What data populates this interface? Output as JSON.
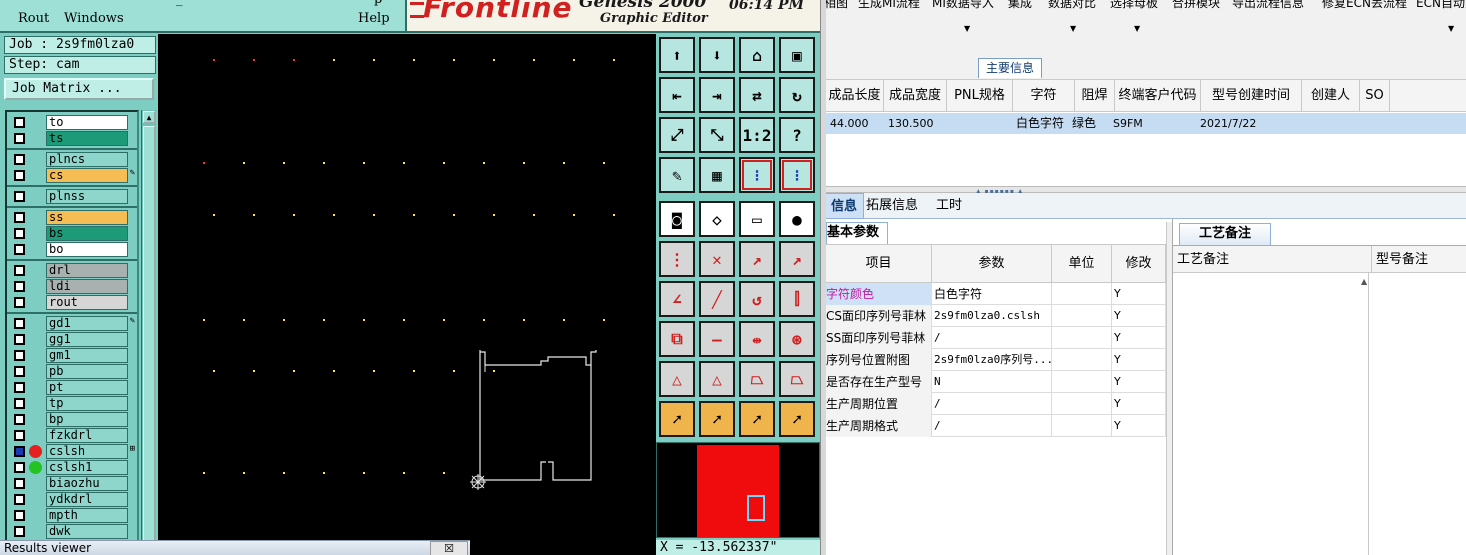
{
  "genesis": {
    "menu_top_fragments": [
      "–",
      "–",
      "–",
      "_",
      "–",
      "–",
      "p"
    ],
    "menu": [
      "Rout",
      "Windows",
      "Help"
    ],
    "brand": "Frontline",
    "product": "Genesis 2000",
    "subtitle": "Graphic Editor",
    "clock": "06:14 PM",
    "job_label": "Job : 2s9fm0lza0",
    "step_label": "Step: cam",
    "job_matrix_button": "Job Matrix ...",
    "layers": [
      {
        "name": "to",
        "color": "#ffffff",
        "flag": ""
      },
      {
        "name": "ts",
        "color": "#1d9a78",
        "flag": ""
      },
      {
        "name": "plncs",
        "color": "#8ed6cb",
        "flag": ""
      },
      {
        "name": "cs",
        "color": "#f6bd55",
        "flag": "✎"
      },
      {
        "name": "plnss",
        "color": "#8ed6cb",
        "flag": ""
      },
      {
        "name": "ss",
        "color": "#f6bd55",
        "flag": ""
      },
      {
        "name": "bs",
        "color": "#1d9a78",
        "flag": ""
      },
      {
        "name": "bo",
        "color": "#ffffff",
        "flag": ""
      },
      {
        "name": "drl",
        "color": "#a9b0b0",
        "flag": ""
      },
      {
        "name": "ldi",
        "color": "#a9b0b0",
        "flag": ""
      },
      {
        "name": "rout",
        "color": "#d6d6d6",
        "flag": ""
      },
      {
        "name": "gd1",
        "color": "#8ed6cb",
        "flag": "✎"
      },
      {
        "name": "gg1",
        "color": "#8ed6cb",
        "flag": ""
      },
      {
        "name": "gm1",
        "color": "#8ed6cb",
        "flag": ""
      },
      {
        "name": "pb",
        "color": "#8ed6cb",
        "flag": ""
      },
      {
        "name": "pt",
        "color": "#8ed6cb",
        "flag": ""
      },
      {
        "name": "tp",
        "color": "#8ed6cb",
        "flag": ""
      },
      {
        "name": "bp",
        "color": "#8ed6cb",
        "flag": ""
      },
      {
        "name": "fzkdrl",
        "color": "#8ed6cb",
        "flag": ""
      },
      {
        "name": "cslsh",
        "color": "#8ed6cb",
        "flag": "⊞",
        "dot": "#e52020",
        "checked": true
      },
      {
        "name": "cslsh1",
        "color": "#8ed6cb",
        "flag": "",
        "dot": "#22c322"
      },
      {
        "name": "biaozhu",
        "color": "#8ed6cb",
        "flag": ""
      },
      {
        "name": "ydkdrl",
        "color": "#8ed6cb",
        "flag": ""
      },
      {
        "name": "mpth",
        "color": "#8ed6cb",
        "flag": ""
      },
      {
        "name": "dwk",
        "color": "#8ed6cb",
        "flag": ""
      }
    ],
    "tools": [
      {
        "name": "move-up-icon",
        "glyph": "⬆",
        "style": "teal"
      },
      {
        "name": "move-down-icon",
        "glyph": "⬇",
        "style": "teal"
      },
      {
        "name": "home-icon",
        "glyph": "⌂",
        "style": "teal"
      },
      {
        "name": "window-icon",
        "glyph": "▣",
        "style": "teal"
      },
      {
        "name": "move-left-icon",
        "glyph": "⇤",
        "style": "teal"
      },
      {
        "name": "move-right-icon",
        "glyph": "⇥",
        "style": "teal"
      },
      {
        "name": "swap-icon",
        "glyph": "⇄",
        "style": "teal"
      },
      {
        "name": "rotate-icon",
        "glyph": "↻",
        "style": "teal"
      },
      {
        "name": "fit-all-icon",
        "glyph": "⤢",
        "style": "teal"
      },
      {
        "name": "zoom-icon",
        "glyph": "⤡",
        "style": "teal"
      },
      {
        "name": "scale-1-2-icon",
        "glyph": "1:2",
        "style": "teal"
      },
      {
        "name": "help-icon",
        "glyph": "?",
        "style": "teal"
      },
      {
        "name": "palette-icon",
        "glyph": "✎",
        "style": "teal"
      },
      {
        "name": "grid-icon",
        "glyph": "▦",
        "style": "teal"
      },
      {
        "name": "snap-connect-icon",
        "glyph": "⁝",
        "style": "redbox"
      },
      {
        "name": "snap-grid-icon",
        "glyph": "⁝",
        "style": "redbox"
      },
      {
        "name": "pad-icon",
        "glyph": "◙",
        "style": "white"
      },
      {
        "name": "draw-polygon-icon",
        "glyph": "◇",
        "style": "white"
      },
      {
        "name": "ruler-icon",
        "glyph": "▭",
        "style": "white"
      },
      {
        "name": "select-pad-icon",
        "glyph": "●",
        "style": "white"
      },
      {
        "name": "net-icon",
        "glyph": "⋮",
        "style": "gray"
      },
      {
        "name": "delete-feature-icon",
        "glyph": "✕",
        "style": "gray"
      },
      {
        "name": "line-add-icon",
        "glyph": "↗",
        "style": "gray"
      },
      {
        "name": "line-move-icon",
        "glyph": "↗",
        "style": "gray"
      },
      {
        "name": "angle-icon",
        "glyph": "∠",
        "style": "gray"
      },
      {
        "name": "line-draw-icon",
        "glyph": "╱",
        "style": "gray"
      },
      {
        "name": "arc-icon",
        "glyph": "↺",
        "style": "gray"
      },
      {
        "name": "mirror-icon",
        "glyph": "⫿",
        "style": "gray"
      },
      {
        "name": "feature-copy-icon",
        "glyph": "⧉",
        "style": "gray"
      },
      {
        "name": "split-line-icon",
        "glyph": "—",
        "style": "gray"
      },
      {
        "name": "measure-width-icon",
        "glyph": "⇹",
        "style": "gray"
      },
      {
        "name": "group-icon",
        "glyph": "⊛",
        "style": "gray"
      },
      {
        "name": "triangle-edit-icon",
        "glyph": "△",
        "style": "gray"
      },
      {
        "name": "triangle-select-icon",
        "glyph": "△",
        "style": "gray"
      },
      {
        "name": "trapezoid-icon",
        "glyph": "⏢",
        "style": "gray"
      },
      {
        "name": "trapezoid-cross-icon",
        "glyph": "⏢",
        "style": "gray"
      },
      {
        "name": "pointer-icon",
        "glyph": "➚",
        "style": "orange"
      },
      {
        "name": "pointer-box-icon",
        "glyph": "➚",
        "style": "orange"
      },
      {
        "name": "pointer-octagon-icon",
        "glyph": "➚",
        "style": "orange"
      },
      {
        "name": "pointer-route-icon",
        "glyph": "➚",
        "style": "orange"
      }
    ],
    "coordinate": "X = -13.562337\"",
    "results_viewer": "Results viewer",
    "results_close": "☒"
  },
  "mi": {
    "toolbar": [
      "相图",
      "生成MI流程",
      "MI数据导入",
      "集成",
      "数据对比",
      "选择母板",
      "合拼模块",
      "导出流程信息",
      "修复ECN丢流程",
      "ECN自动更"
    ],
    "group_tab": "主要信息",
    "grid_columns": [
      "成品长度",
      "成品宽度",
      "PNL规格",
      "字符",
      "阻焊",
      "终端客户代码",
      "型号创建时间",
      "创建人",
      "SO"
    ],
    "grid_row": [
      "44.000",
      "130.500",
      "",
      "白色字符",
      "绿色",
      "S9FM",
      "2021/7/22",
      "",
      ""
    ],
    "sub_tabs": [
      "信息",
      "拓展信息",
      "工时"
    ],
    "param_tab": "基本参数",
    "param_columns": [
      "项目",
      "参数",
      "单位",
      "修改"
    ],
    "params": [
      {
        "item": "字符颜色",
        "value": "白色字符",
        "unit": "",
        "mod": "Y"
      },
      {
        "item": "CS面印序列号菲林",
        "value": "2s9fm0lza0.cslsh",
        "unit": "",
        "mod": "Y"
      },
      {
        "item": "SS面印序列号菲林",
        "value": "/",
        "unit": "",
        "mod": "Y"
      },
      {
        "item": "序列号位置附图",
        "value": "2s9fm0lza0序列号...",
        "unit": "",
        "mod": "Y"
      },
      {
        "item": "是否存在生产型号",
        "value": "N",
        "unit": "",
        "mod": "Y"
      },
      {
        "item": "生产周期位置",
        "value": "/",
        "unit": "",
        "mod": "Y"
      },
      {
        "item": "生产周期格式",
        "value": "/",
        "unit": "",
        "mod": "Y"
      }
    ],
    "notes_tab": "工艺备注",
    "notes_columns": [
      "工艺备注",
      "型号备注"
    ],
    "colors": {
      "selection": "#cfe1f6",
      "highlight_text": "#c01aa0",
      "tab_border": "#8fb1d9"
    }
  }
}
